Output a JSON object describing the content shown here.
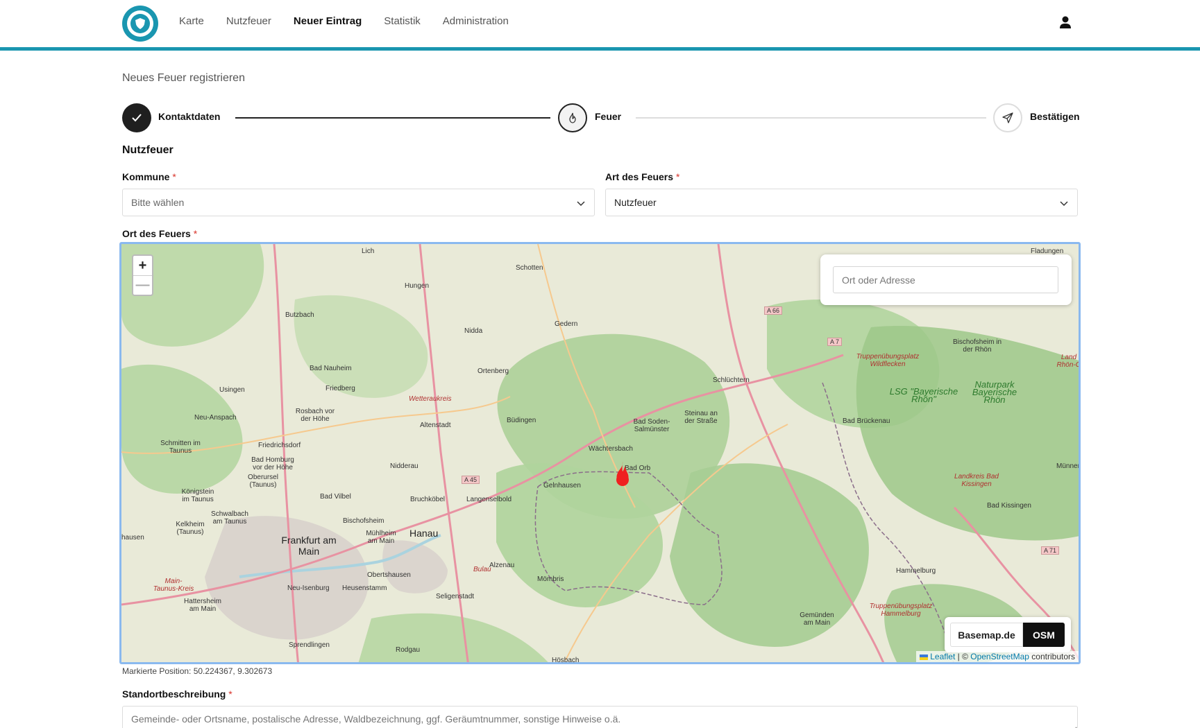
{
  "nav": {
    "items": [
      "Karte",
      "Nutzfeuer",
      "Neuer Eintrag",
      "Statistik",
      "Administration"
    ],
    "active": "Neuer Eintrag"
  },
  "page": {
    "title": "Neues Feuer registrieren"
  },
  "stepper": {
    "steps": [
      {
        "label": "Kontaktdaten",
        "state": "done",
        "icon": "check-icon"
      },
      {
        "label": "Feuer",
        "state": "current",
        "icon": "fire-icon"
      },
      {
        "label": "Bestätigen",
        "state": "pending",
        "icon": "send-icon"
      }
    ]
  },
  "form": {
    "section_title": "Nutzfeuer",
    "kommune": {
      "label": "Kommune",
      "required_mark": "*",
      "value": "Bitte wählen"
    },
    "art": {
      "label": "Art des Feuers",
      "required_mark": "*",
      "value": "Nutzfeuer"
    },
    "ort": {
      "label": "Ort des Feuers",
      "required_mark": "*"
    },
    "standort": {
      "label": "Standortbeschreibung",
      "required_mark": "*",
      "placeholder": "Gemeinde- oder Ortsname, postalische Adresse, Waldbezeichnung, ggf. Geräumtnummer, sonstige Hinweise o.ä."
    }
  },
  "map": {
    "zoom_in": "+",
    "zoom_out": "—",
    "search_placeholder": "Ort oder Adresse",
    "layers": {
      "basemap": "Basemap.de",
      "osm": "OSM",
      "active": "OSM"
    },
    "attribution": {
      "leaflet": "Leaflet",
      "separator": " | © ",
      "osm": "OpenStreetMap",
      "suffix": " contributors"
    },
    "marked_position": "Markierte Position: 50.224367, 9.302673",
    "labels": [
      "Lich",
      "Schotten",
      "Hungen",
      "Butzbach",
      "Nidda",
      "Gedern",
      "Bad Nauheim",
      "Ortenberg",
      "Friedberg",
      "Usingen",
      "Schlüchtern",
      "Bad Soden-Salmünster",
      "Büdingen",
      "Altenstadt",
      "Neu-Anspach",
      "Rosbach vor der Höhe",
      "Wächtersbach",
      "Bad Orb",
      "Gelnhausen",
      "Nidderau",
      "Friedrichsdorf",
      "Bad Homburg vor der Höhe",
      "Oberursel (Taunus)",
      "Königstein im Taunus",
      "Bad Vilbel",
      "Bruchköbel",
      "Langenselbold",
      "Schwalbach am Taunus",
      "Kelkheim (Taunus)",
      "Bischofsheim",
      "Frankfurt am Main",
      "Hanau",
      "Mühlheim am Main",
      "Alzenau",
      "Obertshausen",
      "Neu-Isenburg",
      "Heusenstamm",
      "Seligenstadt",
      "Mömbris",
      "Sprendlingen",
      "Rodgau",
      "Hösbach",
      "Hattersheim am Main",
      "Steinau an der Straße",
      "Bad Brückenau",
      "Bischofsheim in der Rhön",
      "Bad Kissingen",
      "Hammelburg",
      "Gemünden am Main",
      "Fladungen",
      "Schmitten im Taunus",
      "hausen",
      "Münners"
    ],
    "green_labels": [
      "LSG \"Bayerische Rhön\"",
      "Naturpark Bayerische Rhön"
    ],
    "red_labels": [
      "Truppenübungsplatz Wildflecken",
      "Truppenübungsplatz Hammelburg",
      "Landkreis Bad Kissingen",
      "Wetteraukreis",
      "Main-Taunus-Kreis",
      "Bulau",
      "Land Rhön-G"
    ],
    "road_shields": [
      "A 66",
      "A 7",
      "A 45",
      "A 71"
    ]
  }
}
